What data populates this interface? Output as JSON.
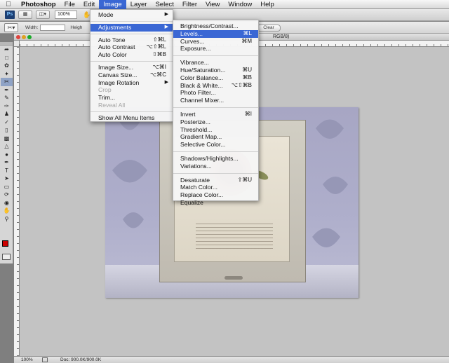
{
  "menubar": {
    "apple_icon": "apple-icon",
    "app_name": "Photoshop",
    "items": [
      "File",
      "Edit",
      "Image",
      "Layer",
      "Select",
      "Filter",
      "View",
      "Window",
      "Help"
    ],
    "active": "Image"
  },
  "appbar": {
    "logo": "Ps",
    "zoom_value": "100%"
  },
  "options": {
    "width_label": "Width:",
    "height_label": "Heigh",
    "clear_label": "Clear"
  },
  "document": {
    "title_fragment": "RGB/8)"
  },
  "image_menu": {
    "mode": "Mode",
    "adjustments": "Adjustments",
    "auto_tone": "Auto Tone",
    "auto_tone_sc": "⇧⌘L",
    "auto_contrast": "Auto Contrast",
    "auto_contrast_sc": "⌥⇧⌘L",
    "auto_color": "Auto Color",
    "auto_color_sc": "⇧⌘B",
    "image_size": "Image Size...",
    "image_size_sc": "⌥⌘I",
    "canvas_size": "Canvas Size...",
    "canvas_size_sc": "⌥⌘C",
    "image_rotation": "Image Rotation",
    "crop": "Crop",
    "trim": "Trim...",
    "reveal_all": "Reveal All",
    "show_all": "Show All Menu Items"
  },
  "adjustments_menu": {
    "brightness": "Brightness/Contrast...",
    "levels": "Levels...",
    "levels_sc": "⌘L",
    "curves": "Curves...",
    "curves_sc": "⌘M",
    "exposure": "Exposure...",
    "vibrance": "Vibrance...",
    "hue_sat": "Hue/Saturation...",
    "hue_sat_sc": "⌘U",
    "color_balance": "Color Balance...",
    "color_balance_sc": "⌘B",
    "bw": "Black & White...",
    "bw_sc": "⌥⇧⌘B",
    "photo_filter": "Photo Filter...",
    "channel_mixer": "Channel Mixer...",
    "invert": "Invert",
    "invert_sc": "⌘I",
    "posterize": "Posterize...",
    "threshold": "Threshold...",
    "gradient_map": "Gradient Map...",
    "selective_color": "Selective Color...",
    "shadows": "Shadows/Highlights...",
    "variations": "Variations...",
    "desaturate": "Desaturate",
    "desaturate_sc": "⇧⌘U",
    "match_color": "Match Color...",
    "replace_color": "Replace Color...",
    "equalize": "Equalize"
  },
  "status": {
    "zoom": "100%",
    "doc_size": "Doc: 900.0K/900.0K"
  },
  "colors": {
    "highlight": "#3a67d4",
    "foreground_swatch": "#cc0000",
    "background_swatch": "#ffffff"
  }
}
